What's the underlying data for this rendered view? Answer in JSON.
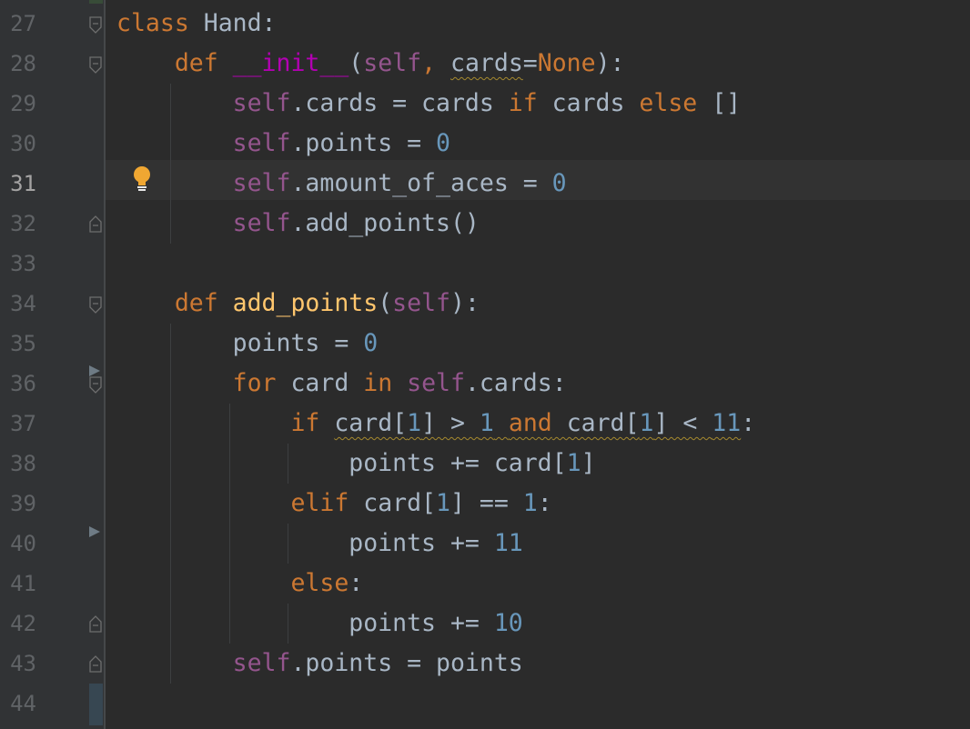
{
  "editor": {
    "current_line": 31,
    "lines": [
      {
        "n": "27",
        "segs": [
          {
            "t": "class ",
            "c": "kw"
          },
          {
            "t": "Hand:",
            "c": "txt"
          }
        ]
      },
      {
        "n": "28",
        "segs": [
          {
            "t": "    def ",
            "c": "kw"
          },
          {
            "t": "__init__",
            "c": "dunder"
          },
          {
            "t": "(",
            "c": "txt"
          },
          {
            "t": "self",
            "c": "self"
          },
          {
            "t": ", ",
            "c": "kw"
          },
          {
            "t": "cards",
            "c": "txt squig"
          },
          {
            "t": "=",
            "c": "txt"
          },
          {
            "t": "None",
            "c": "kw"
          },
          {
            "t": "):",
            "c": "txt"
          }
        ]
      },
      {
        "n": "29",
        "segs": [
          {
            "t": "        ",
            "c": "txt"
          },
          {
            "t": "self",
            "c": "self"
          },
          {
            "t": ".cards = cards ",
            "c": "txt"
          },
          {
            "t": "if",
            "c": "kw"
          },
          {
            "t": " cards ",
            "c": "txt"
          },
          {
            "t": "else",
            "c": "kw"
          },
          {
            "t": " []",
            "c": "txt"
          }
        ]
      },
      {
        "n": "30",
        "segs": [
          {
            "t": "        ",
            "c": "txt"
          },
          {
            "t": "self",
            "c": "self"
          },
          {
            "t": ".points = ",
            "c": "txt"
          },
          {
            "t": "0",
            "c": "num"
          }
        ]
      },
      {
        "n": "31",
        "segs": [
          {
            "t": "        ",
            "c": "txt"
          },
          {
            "t": "self",
            "c": "self"
          },
          {
            "t": ".amount_of_aces = ",
            "c": "txt"
          },
          {
            "t": "0",
            "c": "num"
          }
        ]
      },
      {
        "n": "32",
        "segs": [
          {
            "t": "        ",
            "c": "txt"
          },
          {
            "t": "self",
            "c": "self"
          },
          {
            "t": ".add_points()",
            "c": "txt"
          }
        ]
      },
      {
        "n": "33",
        "segs": []
      },
      {
        "n": "34",
        "segs": [
          {
            "t": "    def ",
            "c": "kw"
          },
          {
            "t": "add_points",
            "c": "fn"
          },
          {
            "t": "(",
            "c": "txt"
          },
          {
            "t": "self",
            "c": "self"
          },
          {
            "t": "):",
            "c": "txt"
          }
        ]
      },
      {
        "n": "35",
        "segs": [
          {
            "t": "        points = ",
            "c": "txt"
          },
          {
            "t": "0",
            "c": "num"
          }
        ]
      },
      {
        "n": "36",
        "segs": [
          {
            "t": "        ",
            "c": "txt"
          },
          {
            "t": "for",
            "c": "kw"
          },
          {
            "t": " card ",
            "c": "txt"
          },
          {
            "t": "in",
            "c": "kw"
          },
          {
            "t": " ",
            "c": "txt"
          },
          {
            "t": "self",
            "c": "self"
          },
          {
            "t": ".cards:",
            "c": "txt"
          }
        ]
      },
      {
        "n": "37",
        "segs": [
          {
            "t": "            ",
            "c": "txt"
          },
          {
            "t": "if",
            "c": "kw"
          },
          {
            "t": " ",
            "c": "txt"
          },
          {
            "t": "card[",
            "c": "txt squig"
          },
          {
            "t": "1",
            "c": "num squig"
          },
          {
            "t": "] > ",
            "c": "txt squig"
          },
          {
            "t": "1",
            "c": "num squig"
          },
          {
            "t": " ",
            "c": "txt squig"
          },
          {
            "t": "and",
            "c": "kw squig"
          },
          {
            "t": " card[",
            "c": "txt squig"
          },
          {
            "t": "1",
            "c": "num squig"
          },
          {
            "t": "] < ",
            "c": "txt squig"
          },
          {
            "t": "11",
            "c": "num squig"
          },
          {
            "t": ":",
            "c": "txt"
          }
        ]
      },
      {
        "n": "38",
        "segs": [
          {
            "t": "                points += card[",
            "c": "txt"
          },
          {
            "t": "1",
            "c": "num"
          },
          {
            "t": "]",
            "c": "txt"
          }
        ]
      },
      {
        "n": "39",
        "segs": [
          {
            "t": "            ",
            "c": "txt"
          },
          {
            "t": "elif",
            "c": "kw"
          },
          {
            "t": " card[",
            "c": "txt"
          },
          {
            "t": "1",
            "c": "num"
          },
          {
            "t": "] == ",
            "c": "txt"
          },
          {
            "t": "1",
            "c": "num"
          },
          {
            "t": ":",
            "c": "txt"
          }
        ]
      },
      {
        "n": "40",
        "segs": [
          {
            "t": "                points += ",
            "c": "txt"
          },
          {
            "t": "11",
            "c": "num"
          }
        ]
      },
      {
        "n": "41",
        "segs": [
          {
            "t": "            ",
            "c": "txt"
          },
          {
            "t": "else",
            "c": "kw"
          },
          {
            "t": ":",
            "c": "txt"
          }
        ]
      },
      {
        "n": "42",
        "segs": [
          {
            "t": "                points += ",
            "c": "txt"
          },
          {
            "t": "10",
            "c": "num"
          }
        ]
      },
      {
        "n": "43",
        "segs": [
          {
            "t": "        ",
            "c": "txt"
          },
          {
            "t": "self",
            "c": "self"
          },
          {
            "t": ".points = points",
            "c": "txt"
          }
        ]
      },
      {
        "n": "44",
        "segs": []
      }
    ]
  },
  "icons": {
    "bulb": "lightbulb-icon",
    "fold": "fold-marker-icon",
    "breakpoint_arrow": "play-arrow-icon"
  },
  "colors": {
    "background": "#2b2b2b",
    "keyword": "#cc7832",
    "self": "#94558d",
    "number": "#6897bb",
    "function": "#ffc66d",
    "dunder": "#b200b2",
    "text": "#a9b7c6"
  }
}
